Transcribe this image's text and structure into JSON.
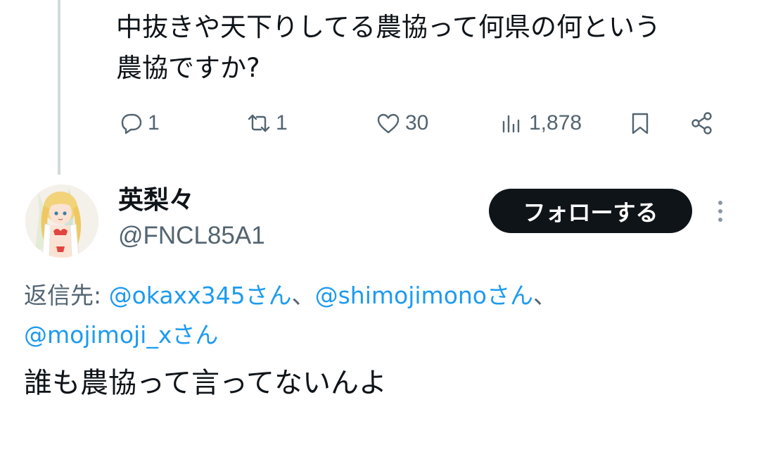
{
  "previous_tweet": {
    "text": "中抜きや天下りしてる農協って何県の何という\n農協ですか?",
    "actions": {
      "replies": "1",
      "retweets": "1",
      "likes": "30",
      "views": "1,878"
    }
  },
  "reply_tweet": {
    "author": {
      "display_name": "英梨々",
      "handle": "@FNCL85A1"
    },
    "follow_label": "フォローする",
    "reply_to": {
      "prefix": "返信先: ",
      "mentions": [
        "@okaxx345さん",
        "@shimojimonoさん",
        "@mojimoji_xさん"
      ],
      "separator": "、"
    },
    "text": "誰も農協って言ってないんよ"
  },
  "colors": {
    "text": "#0f1419",
    "secondary": "#536471",
    "link": "#1d9bf0",
    "button_bg": "#0f1419",
    "thread_line": "#cfd9de"
  }
}
